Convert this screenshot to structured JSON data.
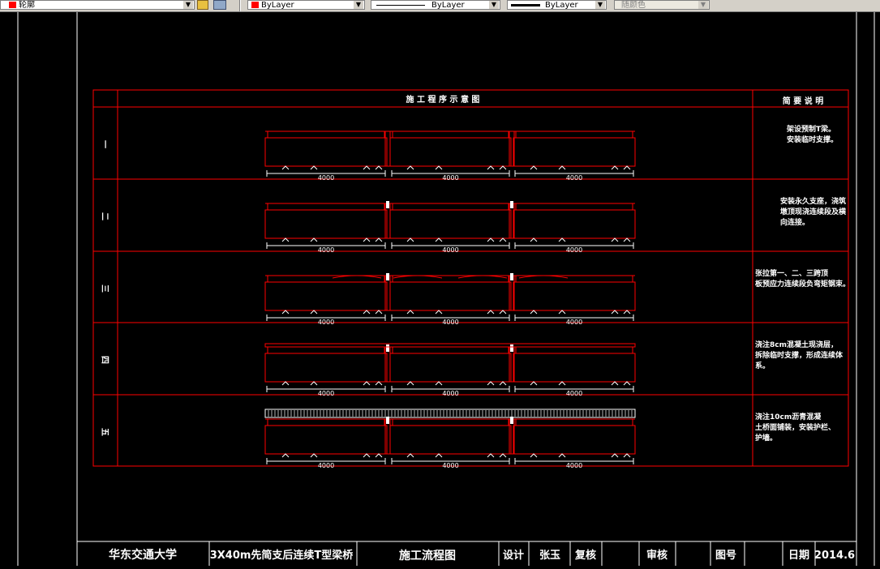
{
  "toolbar": {
    "layer_name": "轮廓",
    "color_value": "ByLayer",
    "linetype_value": "ByLayer",
    "lineweight_value": "ByLayer",
    "plotstyle_value": "随颜色",
    "colors": {
      "layer": "#ff0000",
      "bg": "#d4d0c8"
    }
  },
  "drawing": {
    "header": {
      "diagram_title": "施 工 程 序 示 意 图",
      "notes_title": "简 要 说 明"
    },
    "span_label": "4000",
    "steps": [
      {
        "label": "一",
        "note_lines": [
          "架设预制T梁。",
          "安装临时支撑。"
        ]
      },
      {
        "label": "二",
        "note_lines": [
          "安装永久支座，浇筑",
          "墩顶现浇连续段及横",
          "向连接。"
        ]
      },
      {
        "label": "三",
        "note_lines": [
          "张拉第一、二、三跨顶",
          "板预应力连续段负弯矩钢束。"
        ]
      },
      {
        "label": "四",
        "note_lines": [
          "浇注8cm混凝土现浇层，",
          "拆除临时支撑，形成连续体",
          "系。"
        ]
      },
      {
        "label": "五",
        "note_lines": [
          "浇注10cm沥青混凝",
          "土桥面铺装，安装护栏、",
          "护墙。"
        ]
      }
    ],
    "title_block": {
      "university": "华东交通大学",
      "project": "3X40m先简支后连续T型梁桥",
      "drawing_name": "施工流程图",
      "design_label": "设计",
      "designer": "张玉",
      "review_label": "复核",
      "reviewer": "",
      "approve_label": "审核",
      "approver": "",
      "drawing_no_label": "图号",
      "drawing_no": "",
      "date_label": "日期",
      "date": "2014.6"
    },
    "colors": {
      "background": "#000000",
      "frame": "#ffffff",
      "table_border": "#ff0000",
      "text": "#ffffff",
      "beam": "#ff0000",
      "dimension": "#ffffff"
    }
  }
}
